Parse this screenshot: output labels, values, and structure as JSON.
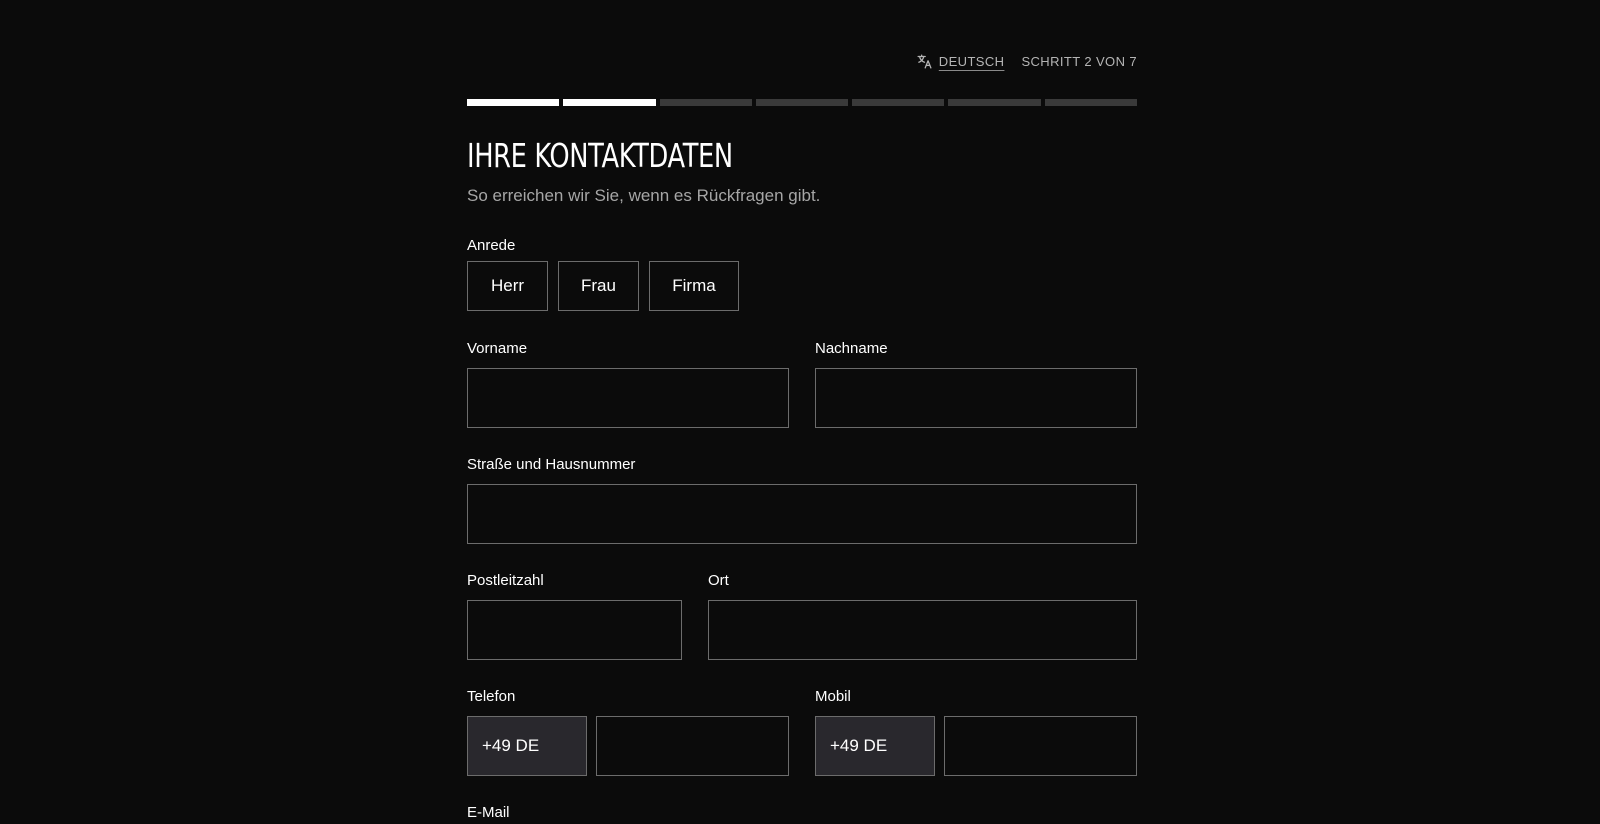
{
  "header": {
    "language_label": "DEUTSCH",
    "step_label": "SCHRITT 2 VON 7",
    "language_icon": "translate-icon"
  },
  "progress": {
    "current_step": 2,
    "total_steps": 7
  },
  "form": {
    "title": "IHRE KONTAKTDATEN",
    "subtitle": "So erreichen wir Sie, wenn es Rückfragen gibt.",
    "salutation": {
      "label": "Anrede",
      "options": [
        "Herr",
        "Frau",
        "Firma"
      ]
    },
    "first_name": {
      "label": "Vorname",
      "value": ""
    },
    "last_name": {
      "label": "Nachname",
      "value": ""
    },
    "street": {
      "label": "Straße und Hausnummer",
      "value": ""
    },
    "postal_code": {
      "label": "Postleitzahl",
      "value": ""
    },
    "city": {
      "label": "Ort",
      "value": ""
    },
    "phone": {
      "label": "Telefon",
      "prefix": "+49 DE",
      "value": ""
    },
    "mobile": {
      "label": "Mobil",
      "prefix": "+49 DE",
      "value": ""
    },
    "email": {
      "label": "E-Mail"
    }
  },
  "colors": {
    "background": "#0b0b0b",
    "progress_done": "#ffffff",
    "progress_todo": "#3a3a3a",
    "border": "#6c6c6c",
    "prefix_bg": "#29282d"
  }
}
